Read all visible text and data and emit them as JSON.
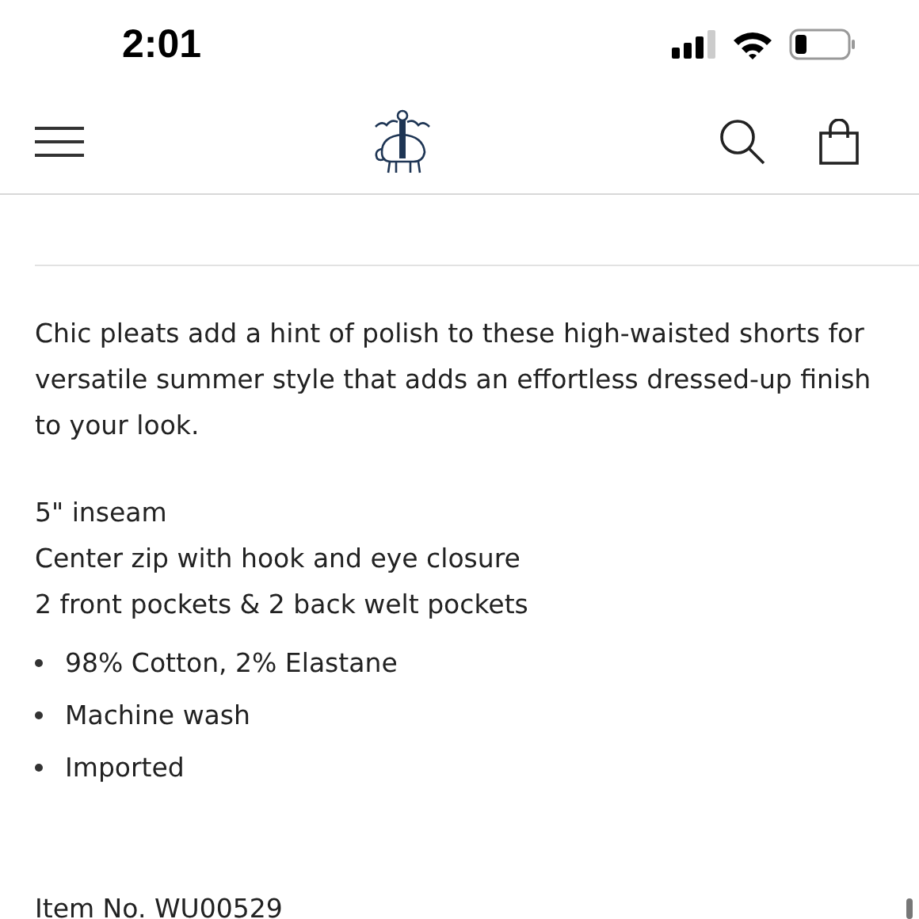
{
  "status_bar": {
    "time": "2:01"
  },
  "description": "Chic pleats add a hint of polish to these high-waisted shorts for versatile summer style that adds an effortless dressed-up finish to your look.",
  "details": [
    "5\" inseam",
    "Center zip with hook and eye closure",
    "2 front pockets & 2 back welt pockets"
  ],
  "features": [
    "98% Cotton, 2% Elastane",
    "Machine wash",
    "Imported"
  ],
  "item_number": "Item No. WU00529"
}
